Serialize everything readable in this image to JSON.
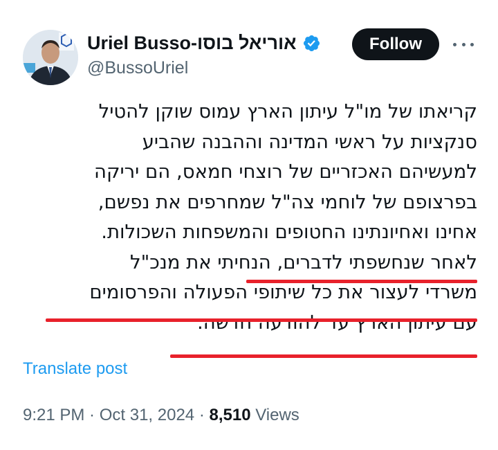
{
  "author": {
    "display_name": "Uriel Busso-אוריאל בוסו",
    "handle": "@BussoUriel",
    "verified": true,
    "verified_color": "#1d9bf0"
  },
  "header": {
    "follow_label": "Follow",
    "more_icon": "more-horizontal-icon"
  },
  "tweet": {
    "lines": [
      "קריאתו של מו\"ל עיתון הארץ עמוס שוקן להטיל",
      "סנקציות על ראשי המדינה וההבנה שהביע",
      "למעשיהם האכזריים של רוצחי חמאס, הם יריקה",
      "בפרצופם של לוחמי צה\"ל שמחרפים את נפשם,",
      "אחינו ואחיונתינו החטופים והמשפחות השכולות.",
      "לאחר שנחשפתי לדברים, הנחיתי את מנכ\"ל",
      "משרדי לעצור את כל שיתופי הפעולה והפרסומים",
      "עם עיתון הארץ עד להודעה חדשה."
    ],
    "annotation_color": "#e8212b"
  },
  "translate_label": "Translate post",
  "meta": {
    "time": "9:21 PM",
    "separator": " · ",
    "date": "Oct 31, 2024",
    "views_count": "8,510",
    "views_label": "Views"
  }
}
